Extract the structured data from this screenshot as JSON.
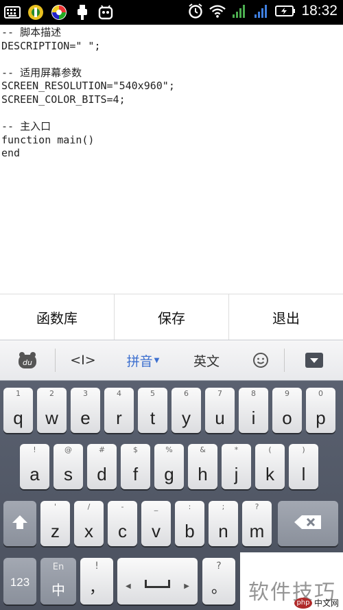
{
  "statusbar": {
    "time": "18:32",
    "left_icons": [
      "keyboard-icon",
      "android-app-icon",
      "sync-app-icon",
      "usb-icon",
      "robot-icon"
    ],
    "right_icons": [
      "alarm-icon",
      "wifi-icon",
      "signal-icon",
      "signal-icon",
      "battery-charging-icon"
    ]
  },
  "editor": {
    "lines": [
      "-- 脚本描述",
      "DESCRIPTION=\" \";",
      "",
      "-- 适用屏幕参数",
      "SCREEN_RESOLUTION=\"540x960\";",
      "SCREEN_COLOR_BITS=4;",
      "",
      "-- 主入口",
      "function main()",
      "end"
    ]
  },
  "actions": {
    "library": "函数库",
    "save": "保存",
    "exit": "退出"
  },
  "ime_bar": {
    "cursor_label": "<I>",
    "pinyin": "拼音",
    "english": "英文"
  },
  "keyboard": {
    "row1": [
      {
        "main": "q",
        "sym": "1"
      },
      {
        "main": "w",
        "sym": "2"
      },
      {
        "main": "e",
        "sym": "3"
      },
      {
        "main": "r",
        "sym": "4"
      },
      {
        "main": "t",
        "sym": "5"
      },
      {
        "main": "y",
        "sym": "6"
      },
      {
        "main": "u",
        "sym": "7"
      },
      {
        "main": "i",
        "sym": "8"
      },
      {
        "main": "o",
        "sym": "9"
      },
      {
        "main": "p",
        "sym": "0"
      }
    ],
    "row2": [
      {
        "main": "a",
        "sym": "!"
      },
      {
        "main": "s",
        "sym": "@"
      },
      {
        "main": "d",
        "sym": "#"
      },
      {
        "main": "f",
        "sym": "$"
      },
      {
        "main": "g",
        "sym": "%"
      },
      {
        "main": "h",
        "sym": "&"
      },
      {
        "main": "j",
        "sym": "*"
      },
      {
        "main": "k",
        "sym": "("
      },
      {
        "main": "l",
        "sym": ")"
      }
    ],
    "row3": [
      {
        "main": "z",
        "sym": "'"
      },
      {
        "main": "x",
        "sym": "/"
      },
      {
        "main": "c",
        "sym": "-"
      },
      {
        "main": "v",
        "sym": "_"
      },
      {
        "main": "b",
        "sym": ":"
      },
      {
        "main": "n",
        "sym": ";"
      },
      {
        "main": "m",
        "sym": "?"
      }
    ],
    "num_key": "123",
    "lang_key_top": "En",
    "lang_key_main": "中",
    "comma_sym": "!",
    "comma_main": "，",
    "period_sym": "?",
    "period_main": "。"
  },
  "watermark": {
    "text": "软件技巧",
    "logo_badge": "php",
    "logo_text": "中文网"
  }
}
